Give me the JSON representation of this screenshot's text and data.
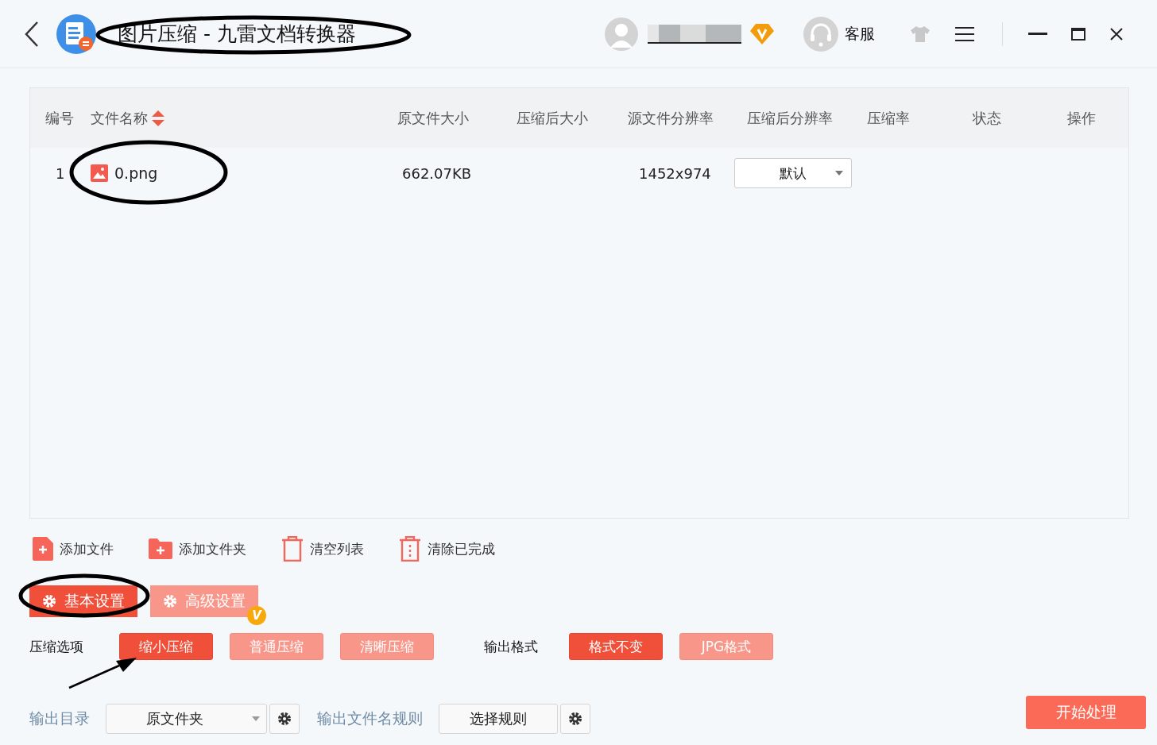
{
  "window": {
    "title": "图片压缩 - 九雷文档转换器",
    "service_label": "客服"
  },
  "table": {
    "columns": [
      "编号",
      "文件名称",
      "原文件大小",
      "压缩后大小",
      "源文件分辨率",
      "压缩后分辨率",
      "压缩率",
      "状态",
      "操作"
    ],
    "rows": [
      {
        "index": "1",
        "name": "0.png",
        "original_size": "662.07KB",
        "source_resolution": "1452x974",
        "target_resolution": "默认"
      }
    ]
  },
  "toolbar": [
    {
      "label": "添加文件",
      "kind": "add-file"
    },
    {
      "label": "添加文件夹",
      "kind": "add-folder"
    },
    {
      "label": "清空列表",
      "kind": "clear"
    },
    {
      "label": "清除已完成",
      "kind": "clear-done"
    }
  ],
  "settings_tabs": [
    {
      "label": "基本设置",
      "selected": true,
      "vip": false
    },
    {
      "label": "高级设置",
      "selected": false,
      "vip": true
    }
  ],
  "vip_badge": "V",
  "compression": {
    "label": "压缩选项",
    "options": [
      {
        "label": "缩小压缩",
        "selected": true
      },
      {
        "label": "普通压缩",
        "selected": false
      },
      {
        "label": "清晰压缩",
        "selected": false
      }
    ]
  },
  "format": {
    "label": "输出格式",
    "options": [
      {
        "label": "格式不变",
        "selected": true
      },
      {
        "label": "JPG格式",
        "selected": false
      }
    ]
  },
  "output": {
    "dir_label": "输出目录",
    "dir_value": "原文件夹",
    "rule_label": "输出文件名规则",
    "rule_button": "选择规则"
  },
  "start_button": "开始处理"
}
